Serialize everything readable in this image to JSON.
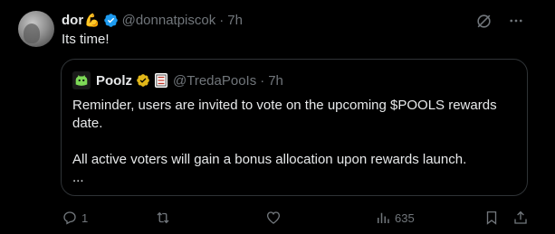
{
  "post": {
    "author_name": "dor",
    "author_emoji": "💪",
    "author_handle": "@donnatpiscok",
    "separator": "·",
    "time": "7h",
    "text": "Its time!"
  },
  "quoted": {
    "author_name": "Poolz",
    "author_handle": "@TredaPooIs",
    "separator": "·",
    "time": "7h",
    "lines": [
      "Reminder, users are invited to vote on the upcoming $POOLS rewards date.",
      "All active voters will gain a bonus allocation upon rewards launch.\n..."
    ]
  },
  "actions": {
    "replies": "1",
    "reposts": "",
    "likes": "",
    "views": "635"
  },
  "colors": {
    "background": "#000000",
    "text": "#e7e9ea",
    "muted": "#71767b",
    "border": "#2f3336",
    "verified_blue": "#1d9bf0",
    "gold": "#e2b719"
  },
  "icons": [
    "grok-icon",
    "more-icon",
    "verified-icon",
    "gold-verified-icon",
    "affiliate-badge-icon",
    "reply-icon",
    "repost-icon",
    "like-icon",
    "views-icon",
    "bookmark-icon",
    "share-icon"
  ]
}
